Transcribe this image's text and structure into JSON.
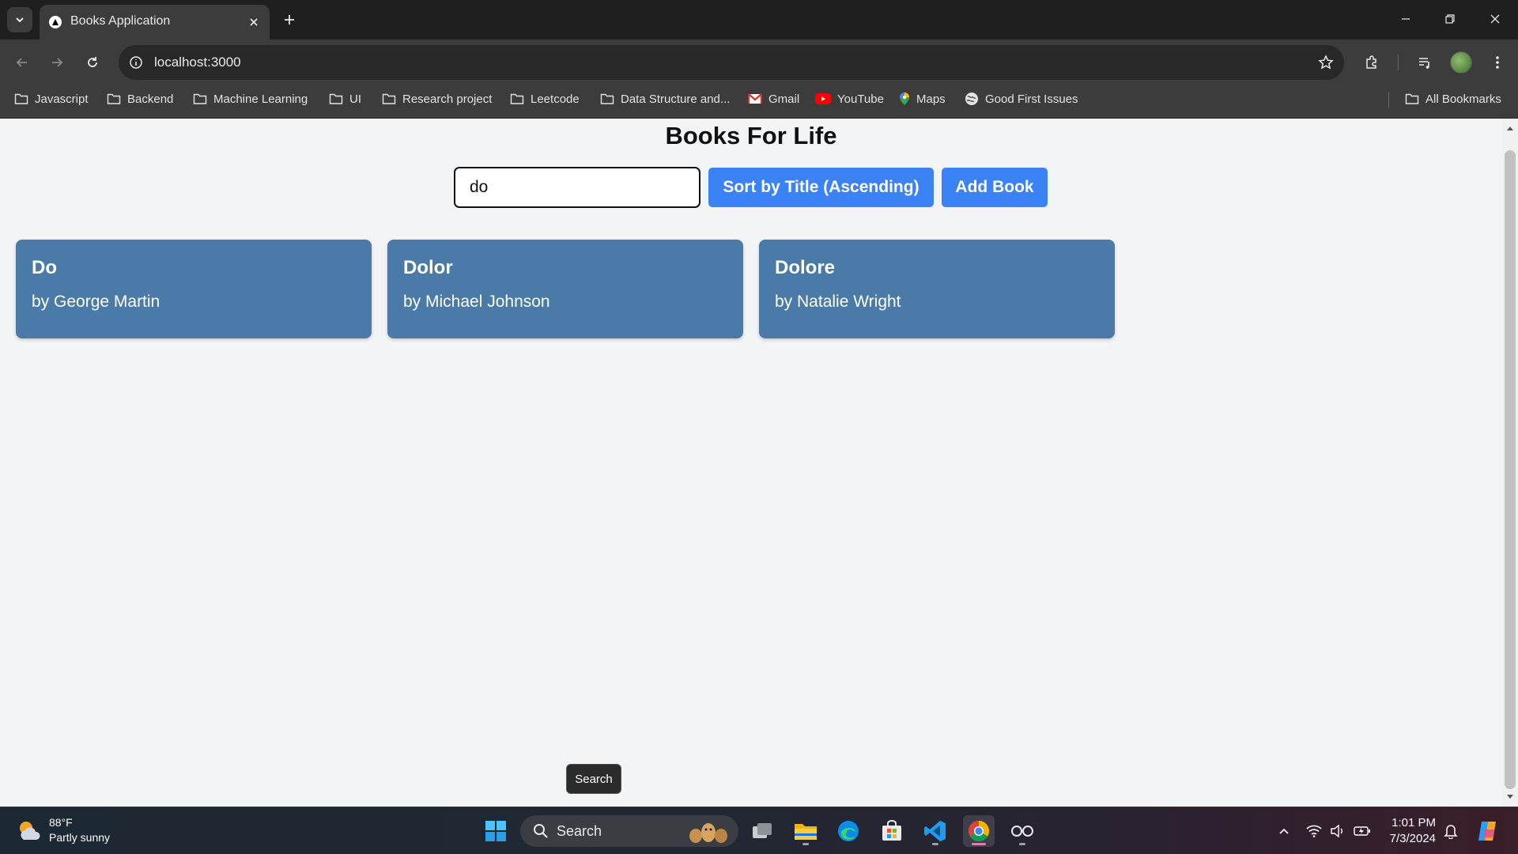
{
  "browser": {
    "tab_title": "Books Application",
    "url": "localhost:3000",
    "bookmarks": [
      {
        "label": "Javascript",
        "icon": "folder-icon"
      },
      {
        "label": "Backend",
        "icon": "folder-icon"
      },
      {
        "label": "Machine Learning",
        "icon": "folder-icon"
      },
      {
        "label": "UI",
        "icon": "folder-icon"
      },
      {
        "label": "Research project",
        "icon": "folder-icon"
      },
      {
        "label": "Leetcode",
        "icon": "folder-icon"
      },
      {
        "label": "Data Structure and...",
        "icon": "folder-icon"
      },
      {
        "label": "Gmail",
        "icon": "gmail-icon"
      },
      {
        "label": "YouTube",
        "icon": "youtube-icon"
      },
      {
        "label": "Maps",
        "icon": "maps-icon"
      },
      {
        "label": "Good First Issues",
        "icon": "globe-icon"
      }
    ],
    "all_bookmarks": "All Bookmarks"
  },
  "page": {
    "title": "Books For Life",
    "search_value": "do",
    "sort_button": "Sort by Title (Ascending)",
    "add_button": "Add Book",
    "books": [
      {
        "title": "Do",
        "author": "by George Martin"
      },
      {
        "title": "Dolor",
        "author": "by Michael Johnson"
      },
      {
        "title": "Dolore",
        "author": "by Natalie Wright"
      }
    ],
    "card_color": "#4a7aa8",
    "button_color": "#3b82f6"
  },
  "tooltip": "Search",
  "taskbar": {
    "weather_temp": "88°F",
    "weather_desc": "Partly sunny",
    "search_label": "Search",
    "time": "1:01 PM",
    "date": "7/3/2024"
  }
}
